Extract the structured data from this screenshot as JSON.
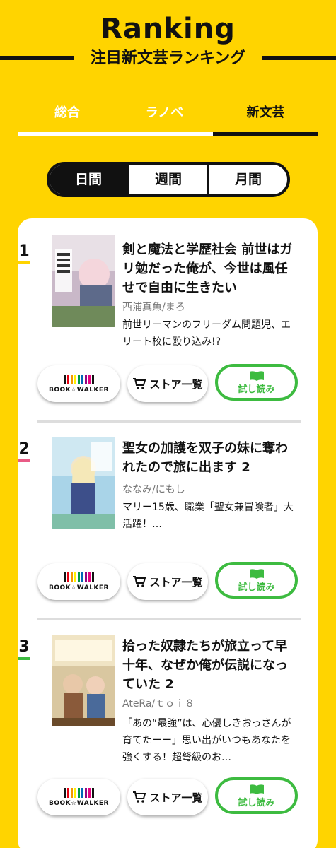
{
  "header": {
    "title": "Ranking",
    "subtitle": "注目新文芸ランキング"
  },
  "tabs": [
    {
      "label": "総合"
    },
    {
      "label": "ラノベ"
    },
    {
      "label": "新文芸"
    }
  ],
  "period": [
    {
      "label": "日間"
    },
    {
      "label": "週間"
    },
    {
      "label": "月間"
    }
  ],
  "colors": {
    "background": "#ffd400",
    "active": "#111111",
    "trial_green": "#3dbb40",
    "rank_marks": [
      "#ffd400",
      "#e95b86",
      "#3dbb40"
    ]
  },
  "buttons": {
    "bookwalker": "BOOK☆WALKER",
    "store": "ストア一覧",
    "trial": "試し読み",
    "cart_icon": "cart-icon",
    "book_icon": "open-book-icon"
  },
  "items": [
    {
      "rank": "1",
      "title": "剣と魔法と学歴社会 前世はガリ勉だった俺が、今世は風任せで自由に生きたい",
      "author": "西浦真魚/まろ",
      "desc": "前世リーマンのフリーダム問題児、エリート校に殴り込み!?"
    },
    {
      "rank": "2",
      "title": "聖女の加護を双子の妹に奪われたので旅に出ます 2",
      "author": "ななみ/にもし",
      "desc": "マリー15歳、職業「聖女兼冒険者」大活躍！…"
    },
    {
      "rank": "3",
      "title": "拾った奴隷たちが旅立って早十年、なぜか俺が伝説になっていた 2",
      "author": "AteRa/ｔｏｉ８",
      "desc": "「あの“最強”は、心優しきおっさんが育てたーー」思い出がいつもあなたを強くする！超弩級のお…"
    }
  ]
}
